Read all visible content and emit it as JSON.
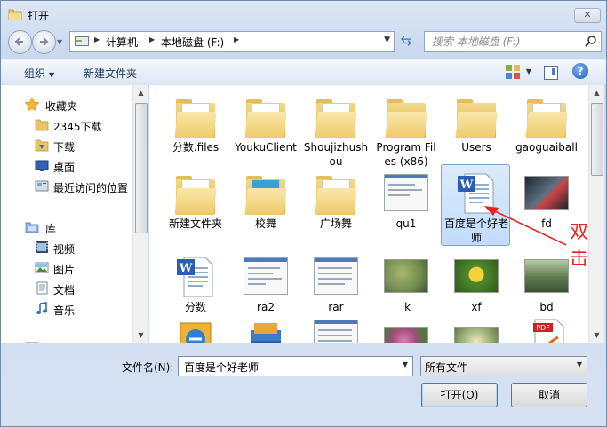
{
  "window": {
    "title": "打开",
    "close_glyph": "✕"
  },
  "address": {
    "crumbs": [
      "计算机",
      "本地磁盘 (F:)"
    ]
  },
  "search": {
    "placeholder": "搜索 本地磁盘 (F:)"
  },
  "toolbar": {
    "organize": "组织",
    "new_folder": "新建文件夹"
  },
  "sidebar": {
    "items": [
      {
        "label": "收藏夹",
        "icon": "star-icon"
      },
      {
        "label": "2345下载",
        "icon": "folder-icon"
      },
      {
        "label": "下载",
        "icon": "download-folder-icon"
      },
      {
        "label": "桌面",
        "icon": "desktop-icon"
      },
      {
        "label": "最近访问的位置",
        "icon": "recent-places-icon"
      },
      {
        "label": "库",
        "icon": "library-icon"
      },
      {
        "label": "视频",
        "icon": "video-library-icon"
      },
      {
        "label": "图片",
        "icon": "pictures-library-icon"
      },
      {
        "label": "文档",
        "icon": "documents-library-icon"
      },
      {
        "label": "音乐",
        "icon": "music-library-icon"
      }
    ]
  },
  "files": [
    {
      "name": "分数.files",
      "kind": "folder"
    },
    {
      "name": "YoukuClient",
      "kind": "folder"
    },
    {
      "name": "Shoujizhushou",
      "kind": "folder"
    },
    {
      "name": "Program Files (x86)",
      "kind": "folder"
    },
    {
      "name": "Users",
      "kind": "folder"
    },
    {
      "name": "gaoguaiball",
      "kind": "folder"
    },
    {
      "name": "新建文件夹",
      "kind": "folder"
    },
    {
      "name": "校舞",
      "kind": "folder"
    },
    {
      "name": "广场舞",
      "kind": "folder"
    },
    {
      "name": "qu1",
      "kind": "screenshot"
    },
    {
      "name": "百度是个好老师",
      "kind": "word-doc",
      "selected": true
    },
    {
      "name": "fd",
      "kind": "image-dark"
    },
    {
      "name": "分数",
      "kind": "word-doc"
    },
    {
      "name": "ra2",
      "kind": "screenshot"
    },
    {
      "name": "rar",
      "kind": "screenshot"
    },
    {
      "name": "lk",
      "kind": "photo",
      "color": "#6f8a4f"
    },
    {
      "name": "xf",
      "kind": "photo",
      "color": "#4f8a2d"
    },
    {
      "name": "bd",
      "kind": "photo",
      "color": "#5b7a49"
    }
  ],
  "partial_row": [
    "archive-icon",
    "books-icon",
    "spreadsheet-icon",
    "photo",
    "photo",
    "pdf-icon"
  ],
  "footer": {
    "filename_label": "文件名(N):",
    "filename_value": "百度是个好老师",
    "filetype_value": "所有文件",
    "open_label": "打开(O)",
    "cancel_label": "取消"
  },
  "annotation": {
    "line1": "双",
    "line2": "击",
    "color": "#e8231c"
  }
}
